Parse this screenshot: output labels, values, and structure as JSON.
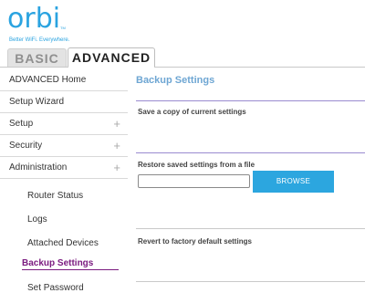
{
  "logo": {
    "word": "orbi",
    "tm": "TM",
    "tagline": "Better WiFi. Everywhere."
  },
  "tabs": [
    {
      "label": "BASIC",
      "active": false
    },
    {
      "label": "ADVANCED",
      "active": true
    }
  ],
  "sidebar": {
    "items": [
      {
        "label": "ADVANCED Home",
        "expandable": false
      },
      {
        "label": "Setup Wizard",
        "expandable": false
      },
      {
        "label": "Setup",
        "expandable": true,
        "icon": "plus-icon"
      },
      {
        "label": "Security",
        "expandable": true,
        "icon": "plus-icon"
      },
      {
        "label": "Administration",
        "expandable": true,
        "icon": "plus-icon"
      }
    ],
    "expand_symbol": "+",
    "subitems": [
      {
        "label": "Router Status",
        "active": false
      },
      {
        "label": "Logs",
        "active": false
      },
      {
        "label": "Attached Devices",
        "active": false
      },
      {
        "label": "Backup Settings",
        "active": true
      },
      {
        "label": "Set Password",
        "active": false
      }
    ]
  },
  "main": {
    "title": "Backup Settings",
    "sections": [
      {
        "label": "Save a copy of current settings"
      },
      {
        "label": "Restore saved settings from a file"
      },
      {
        "label": "Revert to factory default settings"
      }
    ],
    "restore_file_value": "",
    "browse_label": "BROWSE"
  },
  "colors": {
    "brand_blue": "#2aa3e0",
    "active_purple": "#7b1c80",
    "title_blue": "#6ea6d3",
    "button_blue": "#2ca6df",
    "rule_purple": "#9a8bd0"
  }
}
